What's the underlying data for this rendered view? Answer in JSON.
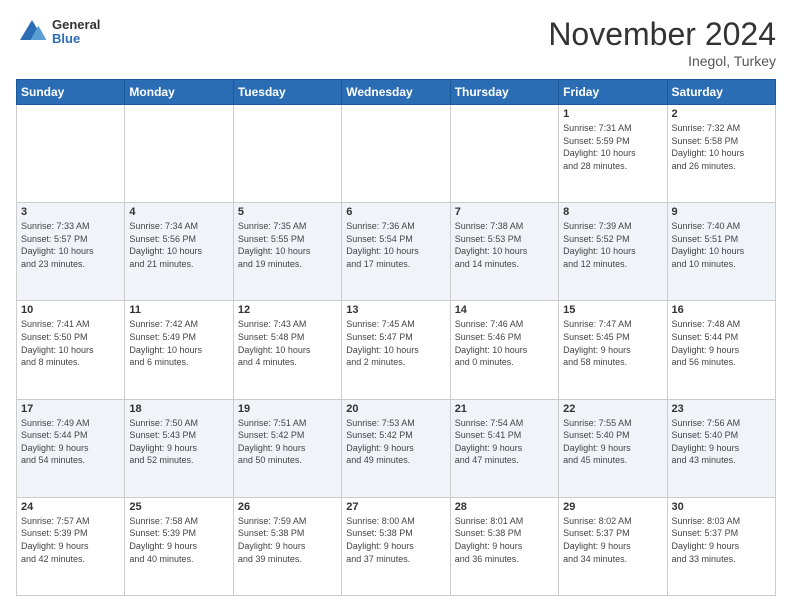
{
  "header": {
    "logo_line1": "General",
    "logo_line2": "Blue",
    "month": "November 2024",
    "location": "Inegol, Turkey"
  },
  "weekdays": [
    "Sunday",
    "Monday",
    "Tuesday",
    "Wednesday",
    "Thursday",
    "Friday",
    "Saturday"
  ],
  "weeks": [
    [
      {
        "day": "",
        "info": ""
      },
      {
        "day": "",
        "info": ""
      },
      {
        "day": "",
        "info": ""
      },
      {
        "day": "",
        "info": ""
      },
      {
        "day": "",
        "info": ""
      },
      {
        "day": "1",
        "info": "Sunrise: 7:31 AM\nSunset: 5:59 PM\nDaylight: 10 hours\nand 28 minutes."
      },
      {
        "day": "2",
        "info": "Sunrise: 7:32 AM\nSunset: 5:58 PM\nDaylight: 10 hours\nand 26 minutes."
      }
    ],
    [
      {
        "day": "3",
        "info": "Sunrise: 7:33 AM\nSunset: 5:57 PM\nDaylight: 10 hours\nand 23 minutes."
      },
      {
        "day": "4",
        "info": "Sunrise: 7:34 AM\nSunset: 5:56 PM\nDaylight: 10 hours\nand 21 minutes."
      },
      {
        "day": "5",
        "info": "Sunrise: 7:35 AM\nSunset: 5:55 PM\nDaylight: 10 hours\nand 19 minutes."
      },
      {
        "day": "6",
        "info": "Sunrise: 7:36 AM\nSunset: 5:54 PM\nDaylight: 10 hours\nand 17 minutes."
      },
      {
        "day": "7",
        "info": "Sunrise: 7:38 AM\nSunset: 5:53 PM\nDaylight: 10 hours\nand 14 minutes."
      },
      {
        "day": "8",
        "info": "Sunrise: 7:39 AM\nSunset: 5:52 PM\nDaylight: 10 hours\nand 12 minutes."
      },
      {
        "day": "9",
        "info": "Sunrise: 7:40 AM\nSunset: 5:51 PM\nDaylight: 10 hours\nand 10 minutes."
      }
    ],
    [
      {
        "day": "10",
        "info": "Sunrise: 7:41 AM\nSunset: 5:50 PM\nDaylight: 10 hours\nand 8 minutes."
      },
      {
        "day": "11",
        "info": "Sunrise: 7:42 AM\nSunset: 5:49 PM\nDaylight: 10 hours\nand 6 minutes."
      },
      {
        "day": "12",
        "info": "Sunrise: 7:43 AM\nSunset: 5:48 PM\nDaylight: 10 hours\nand 4 minutes."
      },
      {
        "day": "13",
        "info": "Sunrise: 7:45 AM\nSunset: 5:47 PM\nDaylight: 10 hours\nand 2 minutes."
      },
      {
        "day": "14",
        "info": "Sunrise: 7:46 AM\nSunset: 5:46 PM\nDaylight: 10 hours\nand 0 minutes."
      },
      {
        "day": "15",
        "info": "Sunrise: 7:47 AM\nSunset: 5:45 PM\nDaylight: 9 hours\nand 58 minutes."
      },
      {
        "day": "16",
        "info": "Sunrise: 7:48 AM\nSunset: 5:44 PM\nDaylight: 9 hours\nand 56 minutes."
      }
    ],
    [
      {
        "day": "17",
        "info": "Sunrise: 7:49 AM\nSunset: 5:44 PM\nDaylight: 9 hours\nand 54 minutes."
      },
      {
        "day": "18",
        "info": "Sunrise: 7:50 AM\nSunset: 5:43 PM\nDaylight: 9 hours\nand 52 minutes."
      },
      {
        "day": "19",
        "info": "Sunrise: 7:51 AM\nSunset: 5:42 PM\nDaylight: 9 hours\nand 50 minutes."
      },
      {
        "day": "20",
        "info": "Sunrise: 7:53 AM\nSunset: 5:42 PM\nDaylight: 9 hours\nand 49 minutes."
      },
      {
        "day": "21",
        "info": "Sunrise: 7:54 AM\nSunset: 5:41 PM\nDaylight: 9 hours\nand 47 minutes."
      },
      {
        "day": "22",
        "info": "Sunrise: 7:55 AM\nSunset: 5:40 PM\nDaylight: 9 hours\nand 45 minutes."
      },
      {
        "day": "23",
        "info": "Sunrise: 7:56 AM\nSunset: 5:40 PM\nDaylight: 9 hours\nand 43 minutes."
      }
    ],
    [
      {
        "day": "24",
        "info": "Sunrise: 7:57 AM\nSunset: 5:39 PM\nDaylight: 9 hours\nand 42 minutes."
      },
      {
        "day": "25",
        "info": "Sunrise: 7:58 AM\nSunset: 5:39 PM\nDaylight: 9 hours\nand 40 minutes."
      },
      {
        "day": "26",
        "info": "Sunrise: 7:59 AM\nSunset: 5:38 PM\nDaylight: 9 hours\nand 39 minutes."
      },
      {
        "day": "27",
        "info": "Sunrise: 8:00 AM\nSunset: 5:38 PM\nDaylight: 9 hours\nand 37 minutes."
      },
      {
        "day": "28",
        "info": "Sunrise: 8:01 AM\nSunset: 5:38 PM\nDaylight: 9 hours\nand 36 minutes."
      },
      {
        "day": "29",
        "info": "Sunrise: 8:02 AM\nSunset: 5:37 PM\nDaylight: 9 hours\nand 34 minutes."
      },
      {
        "day": "30",
        "info": "Sunrise: 8:03 AM\nSunset: 5:37 PM\nDaylight: 9 hours\nand 33 minutes."
      }
    ]
  ]
}
